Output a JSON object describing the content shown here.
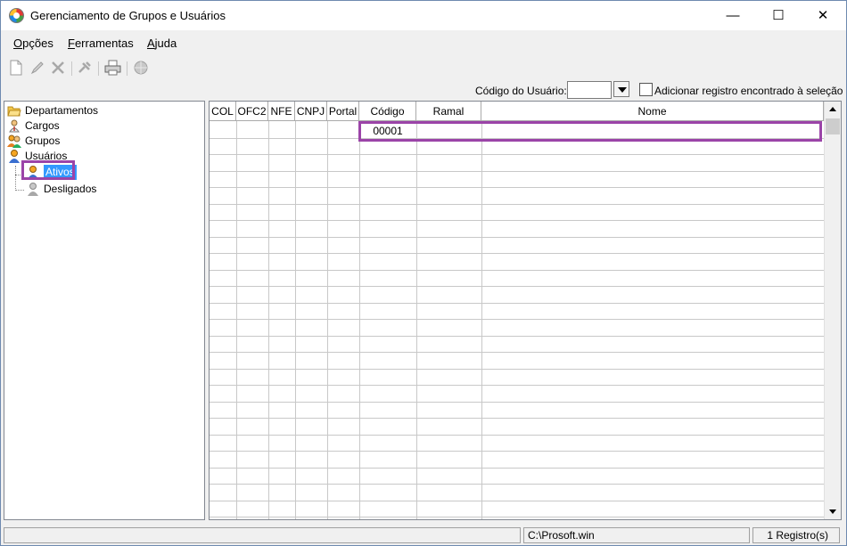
{
  "window": {
    "title": "Gerenciamento de Grupos e Usuários"
  },
  "window_controls": {
    "minimize": "—",
    "maximize": "☐",
    "close": "✕"
  },
  "menu": [
    {
      "label": "Opções",
      "ul": "O",
      "rest": "pções"
    },
    {
      "label": "Ferramentas",
      "ul": "F",
      "rest": "erramentas"
    },
    {
      "label": "Ajuda",
      "ul": "A",
      "rest": "juda"
    }
  ],
  "toolbar": [
    "new-document-icon",
    "edit-pencil-icon",
    "delete-x-icon",
    "tools-icon",
    "print-icon",
    "globe-icon"
  ],
  "search": {
    "code_label": "Código do Usuário:",
    "code_value": "",
    "add_record_label": "Adicionar registro encontrado à seleção",
    "add_record_checked": false
  },
  "tree": {
    "items": [
      {
        "label": "Departamentos",
        "icon": "folder-open-icon"
      },
      {
        "label": "Cargos",
        "icon": "person-role-icon"
      },
      {
        "label": "Grupos",
        "icon": "group-icon"
      },
      {
        "label": "Usuários",
        "icon": "users-icon"
      },
      {
        "label": "Ativos",
        "icon": "user-active-icon",
        "selected": true
      },
      {
        "label": "Desligados",
        "icon": "user-inactive-icon"
      }
    ]
  },
  "grid": {
    "columns": [
      "COL",
      "OFC2",
      "NFE",
      "CNPJ",
      "Portal",
      "Código",
      "Ramal",
      "Nome"
    ],
    "rows": [
      {
        "COL": "",
        "OFC2": "",
        "NFE": "",
        "CNPJ": "",
        "Portal": "",
        "Código": "00001",
        "Ramal": "",
        "Nome": ""
      }
    ]
  },
  "status": {
    "left": "",
    "path": "C:\\Prosoft.win",
    "count": "1 Registro(s)"
  },
  "colors": {
    "accent": "#9b44a8",
    "selection": "#3399ff"
  }
}
